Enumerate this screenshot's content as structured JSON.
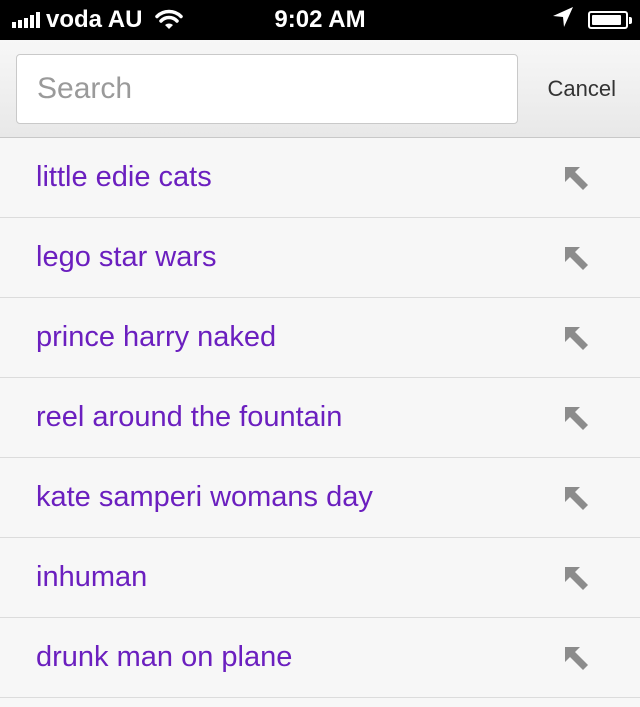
{
  "status_bar": {
    "carrier": "voda AU",
    "time": "9:02 AM",
    "icons": [
      "signal-icon",
      "wifi-icon",
      "location-arrow-icon",
      "battery-icon"
    ],
    "battery_level": 0.9
  },
  "search": {
    "placeholder": "Search",
    "value": "",
    "cancel_label": "Cancel"
  },
  "suggestions": [
    {
      "label": "little edie cats",
      "action_icon": "arrow-up-left-icon"
    },
    {
      "label": "lego star wars",
      "action_icon": "arrow-up-left-icon"
    },
    {
      "label": "prince harry naked",
      "action_icon": "arrow-up-left-icon"
    },
    {
      "label": "reel around the fountain",
      "action_icon": "arrow-up-left-icon"
    },
    {
      "label": "kate samperi womans day",
      "action_icon": "arrow-up-left-icon"
    },
    {
      "label": "inhuman",
      "action_icon": "arrow-up-left-icon"
    },
    {
      "label": "drunk man on plane",
      "action_icon": "arrow-up-left-icon"
    }
  ],
  "colors": {
    "suggestion_text": "#6b1fbf",
    "arrow_icon": "#8c8c8c",
    "status_bar_bg": "#000000"
  }
}
